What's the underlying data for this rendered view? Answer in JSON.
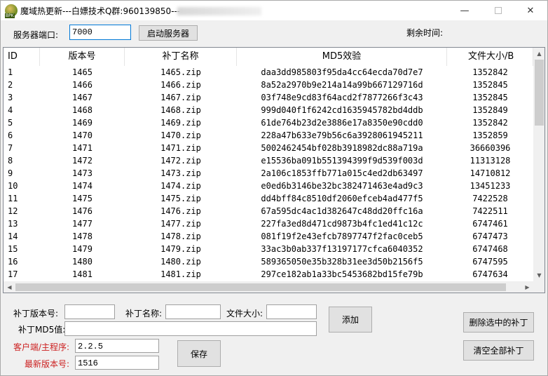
{
  "window": {
    "title": "魔域热更新---白嫖技术Q群:960139850---",
    "app_icon_badge": "BPK",
    "min_glyph": "—",
    "close_glyph": "✕"
  },
  "server": {
    "port_label": "服务器端口:",
    "port_value": "7000",
    "start_button": "启动服务器",
    "remaining_label": "剩余时间:"
  },
  "table": {
    "columns": [
      "ID",
      "版本号",
      "补丁名称",
      "MD5效验",
      "文件大小/B"
    ],
    "rows": [
      [
        "1",
        "1465",
        "1465.zip",
        "daa3dd985803f95da4cc64ecda70d7e7",
        "1352842"
      ],
      [
        "2",
        "1466",
        "1466.zip",
        "8a52a2970b9e214a14a99b667129716d",
        "1352845"
      ],
      [
        "3",
        "1467",
        "1467.zip",
        "03f748e9cd83f64acd2f7877266f3c43",
        "1352845"
      ],
      [
        "4",
        "1468",
        "1468.zip",
        "999d040f1f6242cd1635945782bd4ddb",
        "1352849"
      ],
      [
        "5",
        "1469",
        "1469.zip",
        "61de764b23d2e3886e17a8350e90cdd0",
        "1352842"
      ],
      [
        "6",
        "1470",
        "1470.zip",
        "228a47b633e79b56c6a3928061945211",
        "1352859"
      ],
      [
        "7",
        "1471",
        "1471.zip",
        "5002462454bf028b3918982dc88a719a",
        "36660396"
      ],
      [
        "8",
        "1472",
        "1472.zip",
        "e15536ba091b551394399f9d539f003d",
        "11313128"
      ],
      [
        "9",
        "1473",
        "1473.zip",
        "2a106c1853ffb771a015c4ed2db63497",
        "14710812"
      ],
      [
        "10",
        "1474",
        "1474.zip",
        "e0ed6b3146be32bc382471463e4ad9c3",
        "13451233"
      ],
      [
        "11",
        "1475",
        "1475.zip",
        "dd4bff84c8510df2060efceb4ad477f5",
        "7422528"
      ],
      [
        "12",
        "1476",
        "1476.zip",
        "67a595dc4ac1d382647c48dd20ffc16a",
        "7422511"
      ],
      [
        "13",
        "1477",
        "1477.zip",
        "227fa3ed8d471cd9873b4fc1ed41c12c",
        "6747461"
      ],
      [
        "14",
        "1478",
        "1478.zip",
        "081f19f2e43efcb7897747f2fac0ceb5",
        "6747473"
      ],
      [
        "15",
        "1479",
        "1479.zip",
        "33ac3b0ab337f13197177cfca6040352",
        "6747468"
      ],
      [
        "16",
        "1480",
        "1480.zip",
        "589365050e35b328b31ee3d50b2156f5",
        "6747595"
      ],
      [
        "17",
        "1481",
        "1481.zip",
        "297ce182ab1a33bc5453682bd15fe79b",
        "6747634"
      ]
    ]
  },
  "patch_form": {
    "version_label": "补丁版本号:",
    "version_value": "",
    "name_label": "补丁名称:",
    "name_value": "",
    "size_label": "文件大小:",
    "size_value": "",
    "md5_label": "补丁MD5值:",
    "md5_value": "",
    "add_button": "添加",
    "delete_selected_button": "删除选中的补丁",
    "clear_all_button": "清空全部补丁"
  },
  "client": {
    "main_label": "客户端/主程序:",
    "main_value": "2.2.5",
    "latest_label": "最新版本号:",
    "latest_value": "1516",
    "save_button": "保存"
  },
  "colors": {
    "accent_red": "#cc2020",
    "focus_border": "#0078d7"
  }
}
